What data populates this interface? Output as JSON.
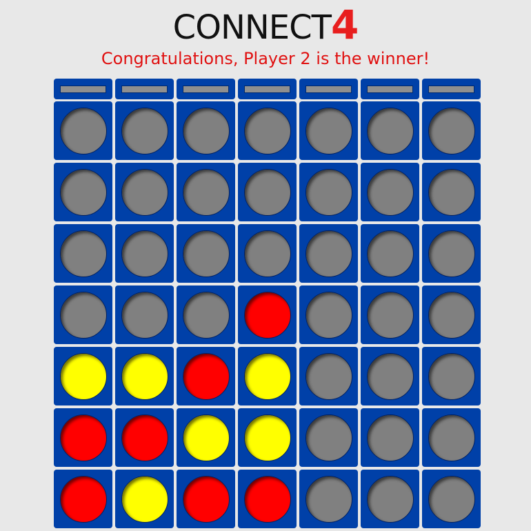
{
  "header": {
    "title_text": "CONNECT",
    "title_number": "4",
    "status_message": "Congratulations, Player 2 is the winner!"
  },
  "colors": {
    "board": "#0040a8",
    "empty": "#808080",
    "player_red": "#ff0000",
    "player_yellow": "#ffff00",
    "title_accent": "#e81e1e",
    "status_text": "#e01010"
  },
  "board": {
    "columns": 7,
    "rows": 7,
    "drop_buttons": 7,
    "grid": [
      [
        "empty",
        "empty",
        "empty",
        "empty",
        "empty",
        "empty",
        "empty"
      ],
      [
        "empty",
        "empty",
        "empty",
        "empty",
        "empty",
        "empty",
        "empty"
      ],
      [
        "empty",
        "empty",
        "empty",
        "empty",
        "empty",
        "empty",
        "empty"
      ],
      [
        "empty",
        "empty",
        "empty",
        "red",
        "empty",
        "empty",
        "empty"
      ],
      [
        "yellow",
        "yellow",
        "red",
        "yellow",
        "empty",
        "empty",
        "empty"
      ],
      [
        "red",
        "red",
        "yellow",
        "yellow",
        "empty",
        "empty",
        "empty"
      ],
      [
        "red",
        "yellow",
        "red",
        "red",
        "empty",
        "empty",
        "empty"
      ]
    ]
  }
}
